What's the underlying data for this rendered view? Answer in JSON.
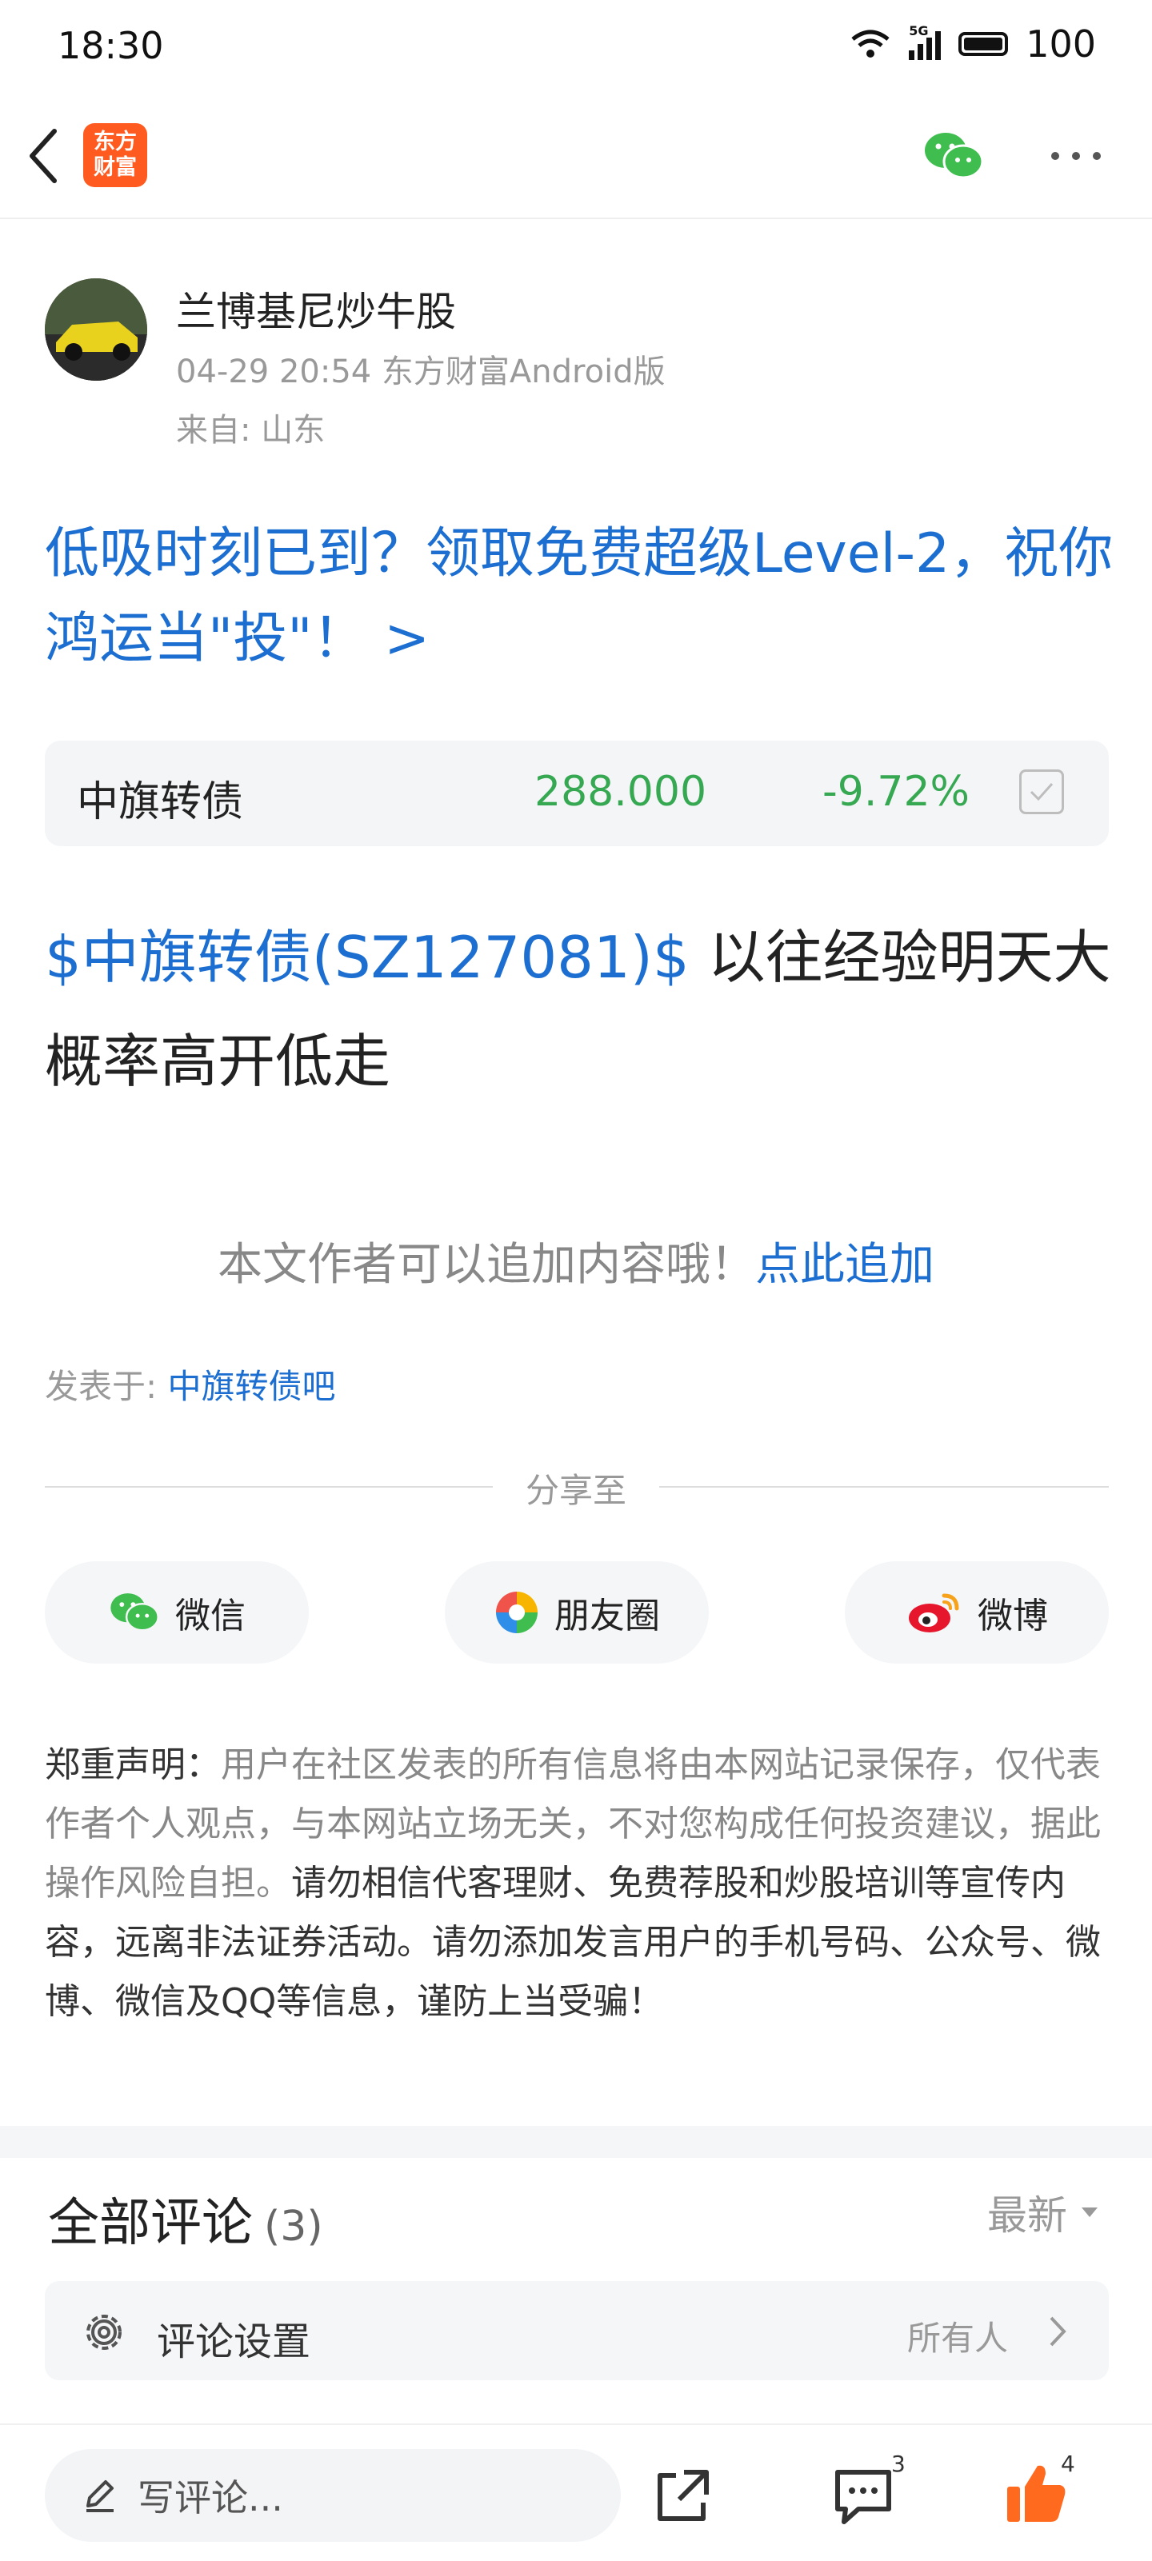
{
  "status_bar": {
    "time": "18:30",
    "network": "5G",
    "battery": "100"
  },
  "nav": {
    "logo_text": "东方财富",
    "back": "back-icon",
    "share": "wechat-icon",
    "more": "more-icon"
  },
  "author": {
    "name": "兰博基尼炒牛股",
    "meta": "04-29 20:54 东方财富Android版",
    "location": "来自: 山东"
  },
  "promo": {
    "text": "低吸时刻已到？领取免费超级Level-2，祝你鸿运当\"投\"！ >"
  },
  "stock": {
    "name": "中旗转债",
    "price": "288.000",
    "change": "-9.72%",
    "change_color": "#36a852"
  },
  "post": {
    "link_text": "$中旗转债(SZ127081)$",
    "body_text": " 以往经验明天大概率高开低走"
  },
  "append": {
    "text": "本文作者可以追加内容哦！",
    "link": "点此追加"
  },
  "posted_in": {
    "label": "发表于: ",
    "bar_name": "中旗转债吧"
  },
  "share": {
    "label": "分享至",
    "items": [
      {
        "label": "微信",
        "icon": "wechat-icon"
      },
      {
        "label": "朋友圈",
        "icon": "moments-icon"
      },
      {
        "label": "微博",
        "icon": "weibo-icon"
      }
    ]
  },
  "disclaimer": {
    "title": "郑重声明：",
    "gray_text": "用户在社区发表的所有信息将由本网站记录保存，仅代表作者个人观点，与本网站立场无关，不对您构成任何投资建议，据此操作风险自担。",
    "dark_text": "请勿相信代客理财、免费荐股和炒股培训等宣传内容，远离非法证券活动。请勿添加发言用户的手机号码、公众号、微博、微信及QQ等信息，谨防上当受骗！"
  },
  "comments": {
    "title": "全部评论",
    "count": "(3)",
    "sort": "最新",
    "settings_label": "评论设置",
    "settings_scope": "所有人"
  },
  "bottom": {
    "input_placeholder": "写评论...",
    "comment_count": "3",
    "like_count": "4",
    "accent": "#ff6a1f"
  }
}
